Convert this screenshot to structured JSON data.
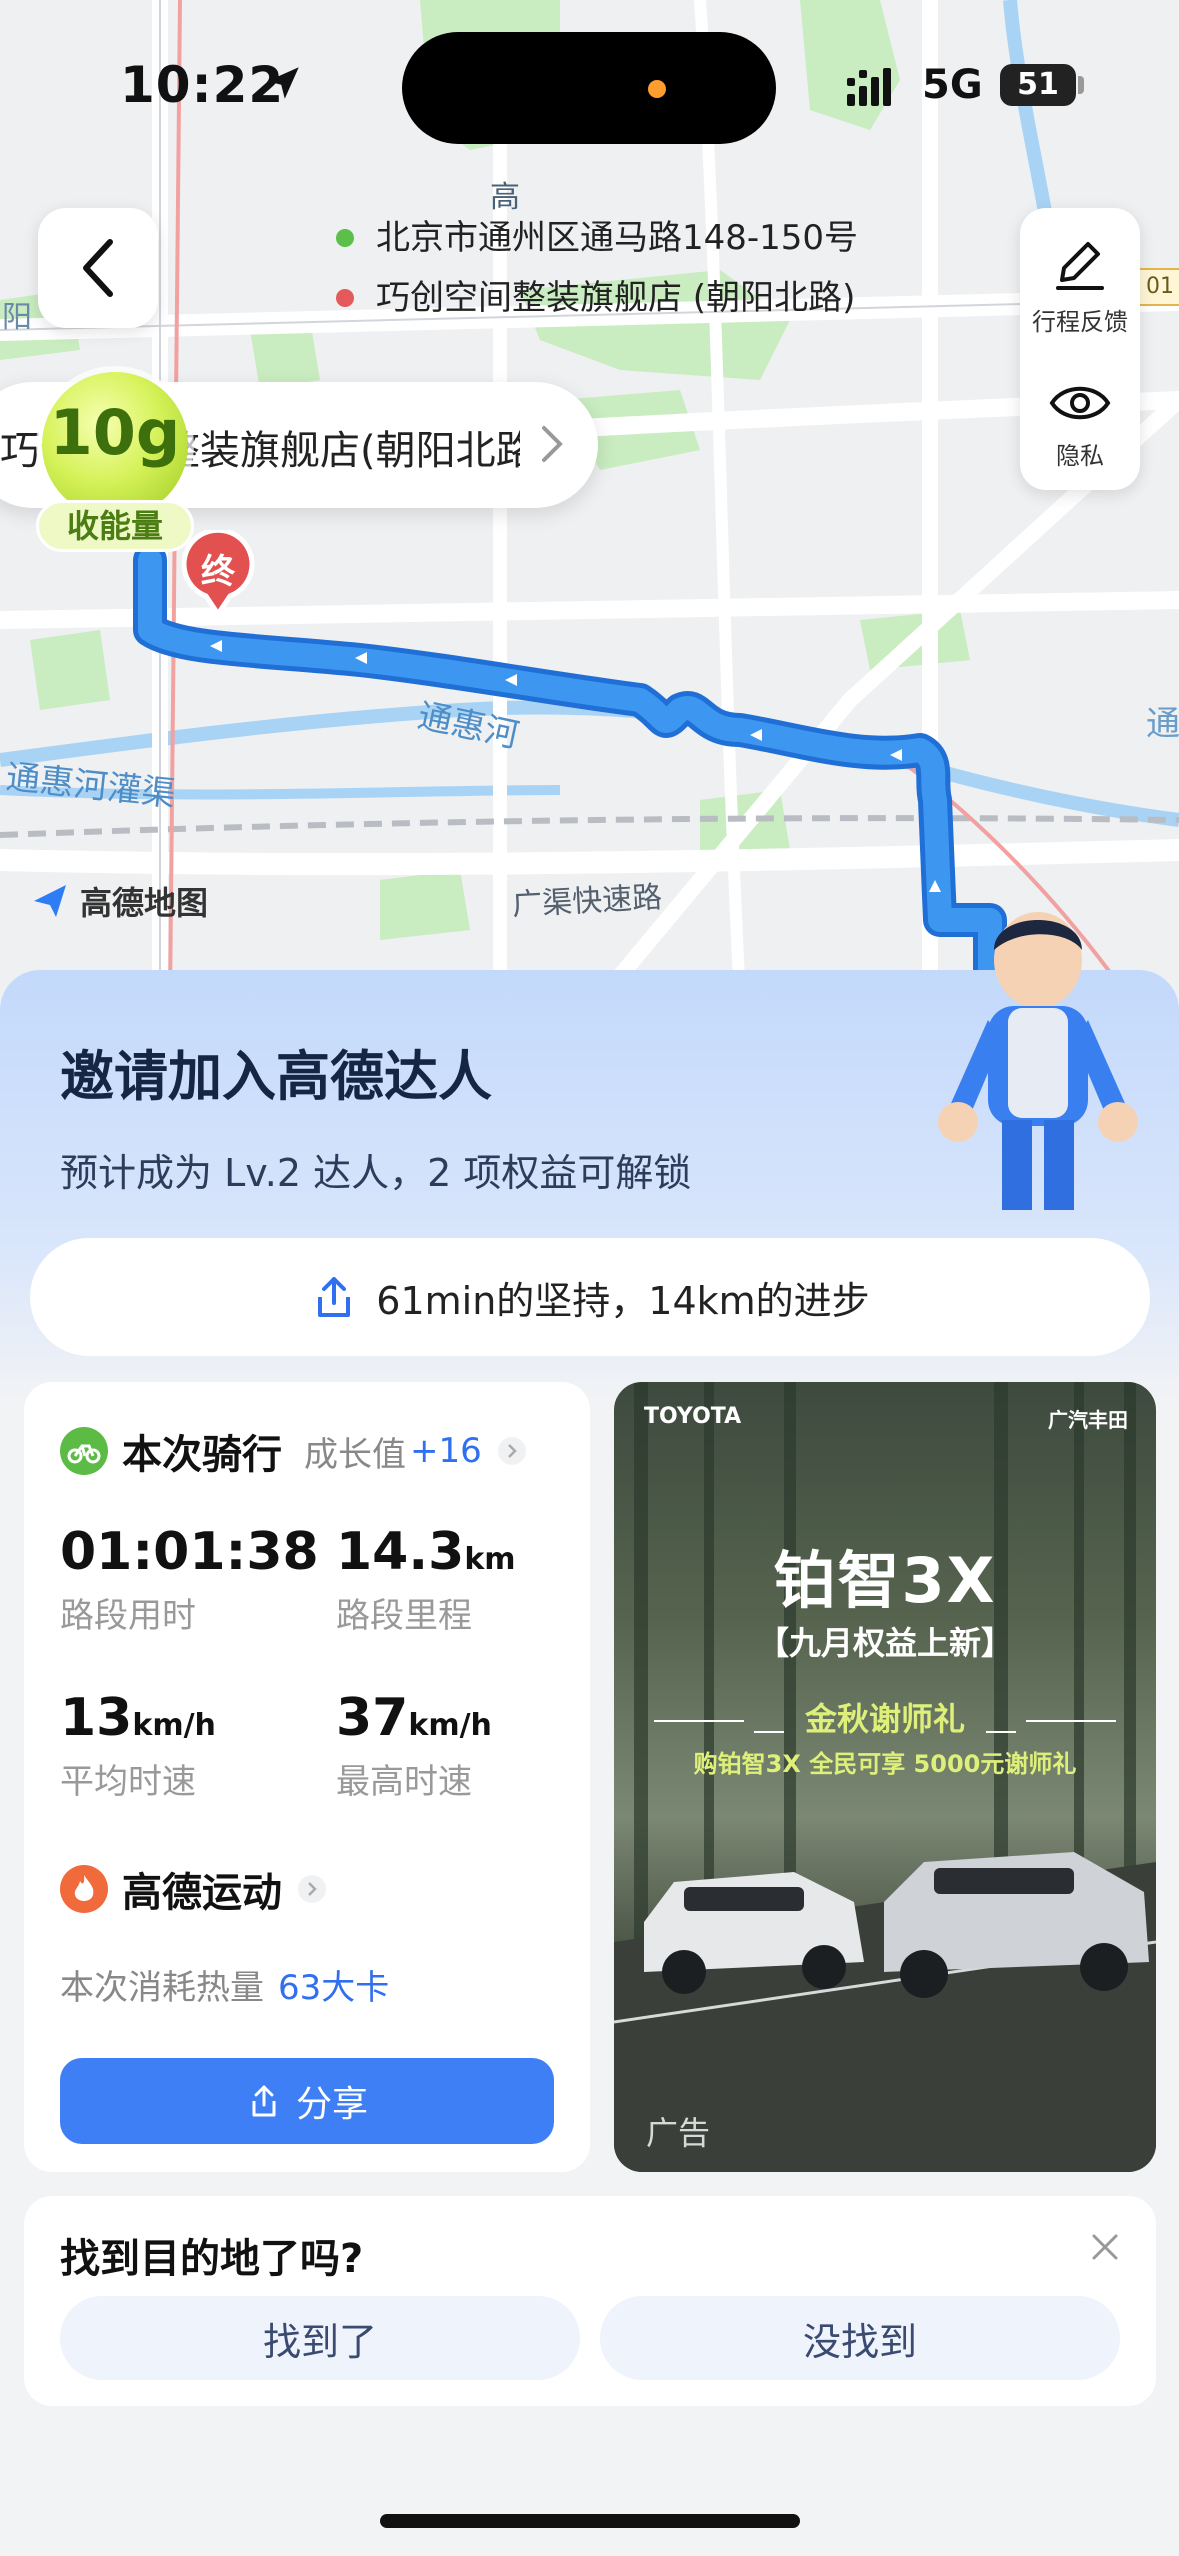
{
  "status_bar": {
    "time": "10:22",
    "network": "5G",
    "battery": "51"
  },
  "map": {
    "start_address": "北京市通州区通马路148-150号",
    "end_address": "巧创空间整装旗舰店 (朝阳北路)",
    "destination_pill": "巧创空间整装旗舰店(朝阳北路)",
    "energy_value": "10g",
    "energy_label": "收能量",
    "end_marker": "终",
    "labels": {
      "river": "通惠河",
      "canal": "通惠河灌渠",
      "expressway": "广渠快速路",
      "road_vertical": "高",
      "district": "阳",
      "edge_right": "通",
      "road_badge": "01"
    },
    "logo_text": "高德地图",
    "side_panel": {
      "feedback": "行程反馈",
      "privacy": "隐私"
    },
    "colors": {
      "route": "#3d97f0",
      "start_dot": "#5cbf4a",
      "end_dot": "#e45a5a"
    }
  },
  "invite": {
    "title": "邀请加入高德达人",
    "subtitle": "预计成为 Lv.2 达人，2 项权益可解锁",
    "progress": "61min的坚持，14km的进步"
  },
  "ride": {
    "title": "本次骑行",
    "growth_label": "成长值",
    "growth_value": "+16",
    "stats": [
      {
        "value": "01:01:38",
        "unit": "",
        "label": "路段用时"
      },
      {
        "value": "14.3",
        "unit": "km",
        "label": "路段里程"
      },
      {
        "value": "13",
        "unit": "km/h",
        "label": "平均时速"
      },
      {
        "value": "37",
        "unit": "km/h",
        "label": "最高时速"
      }
    ],
    "sport_title": "高德运动",
    "calorie_label": "本次消耗热量",
    "calorie_value": "63大卡",
    "share_label": "分享"
  },
  "ad": {
    "brand_left": "TOYOTA",
    "brand_right": "广汽丰田",
    "title": "铂智3X",
    "subtitle": "【九月权益上新】",
    "gift": "金秋谢师礼",
    "offer": "购铂智3X 全民可享 5000元谢师礼",
    "tag": "广告"
  },
  "found": {
    "title": "找到目的地了吗?",
    "yes": "找到了",
    "no": "没找到"
  }
}
